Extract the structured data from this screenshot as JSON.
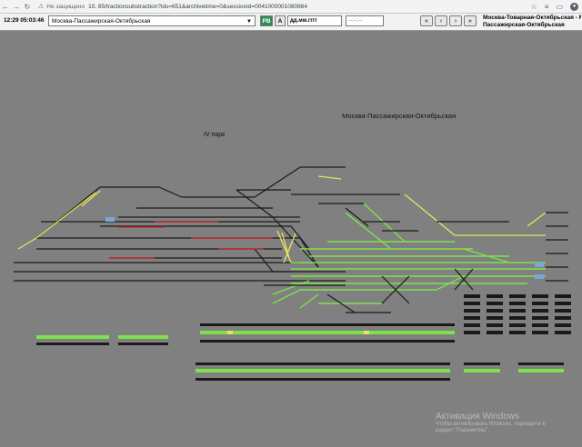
{
  "browser": {
    "security_label": "Не защищено",
    "url": "10.              85/tractionsubstraction?ids=651&archivetime=0&sessionid=0041000001080864"
  },
  "toolbar": {
    "time": "12:29 05:03:46",
    "station_select": "Москва-Пассажирская-Октябрьская",
    "btn_pv": "РВ",
    "btn_a": "А",
    "date_placeholder": "дд.мм.гггг",
    "time_placeholder": "--:--:--",
    "nav_first": "«",
    "nav_prev": "‹",
    "nav_next": "›",
    "nav_last": "»",
    "ticker_line1": "Москва-Товарная-Октябрьская - Моск",
    "ticker_line2": "Пассажирская-Октябрьская"
  },
  "scheme": {
    "station_title": "Москва-Пассажирская-Октябрьская",
    "park_label": "IV парк"
  },
  "colors": {
    "background": "#808080",
    "track": "#1a1a1a",
    "energized": "#7ee24a",
    "yellow_route": "#e6e65a",
    "fault_red": "#d22020",
    "node_blue": "#7aa7d8"
  },
  "watermark": {
    "title": "Активация Windows",
    "subtitle_line1": "Чтобы активировать Windows, перейдите в",
    "subtitle_line2": "раздел \"Параметры\"."
  }
}
